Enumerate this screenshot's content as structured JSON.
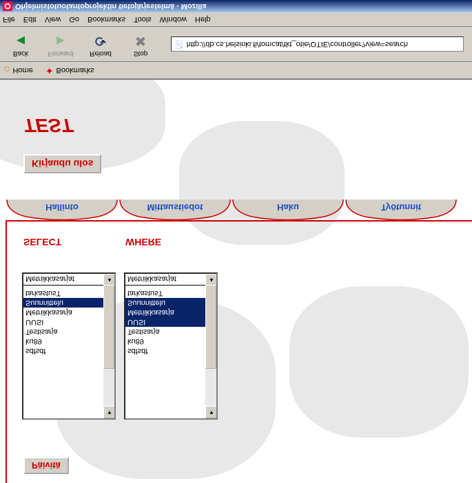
{
  "window": {
    "title": "Ohjelmistotuotantoprojektin tietojärjestelmä - Mozilla"
  },
  "menu": [
    "File",
    "Edit",
    "View",
    "Go",
    "Bookmarks",
    "Tools",
    "Window",
    "Help"
  ],
  "nav": {
    "back": "Back",
    "forward": "Forward",
    "reload": "Reload",
    "stop": "Stop",
    "url": "http://db.cs.helsinki.fi/tomcat/tkt_otie/OTIE/controller?view=search"
  },
  "bookmarks": {
    "home": "Home",
    "bookmarks": "Bookmarks"
  },
  "page": {
    "headline": "TEST",
    "logout": "Kirjaudu ulos",
    "tabs": [
      "Hallinto",
      "Mittaustiedot",
      "Haku",
      "Työtunnit"
    ],
    "select_label": "SELECT",
    "where_label": "WHERE",
    "listbox1": {
      "items": [
        "Metriikkasarjat",
        "",
        "tarkastusT",
        "Suunnittelu",
        "Metriikkasarja",
        "UUSI",
        "Testisarja",
        "ku89",
        "sdfsdf"
      ],
      "selected": [
        3
      ]
    },
    "listbox2": {
      "items": [
        "Metriikkasarjat",
        "",
        "tarkastusT",
        "Suunnittelu",
        "Metriikkasarja",
        "UUSI",
        "Testisarja",
        "ku89",
        "sdfsdf"
      ],
      "selected": [
        3,
        4,
        5
      ]
    },
    "update": "Päivitä"
  }
}
